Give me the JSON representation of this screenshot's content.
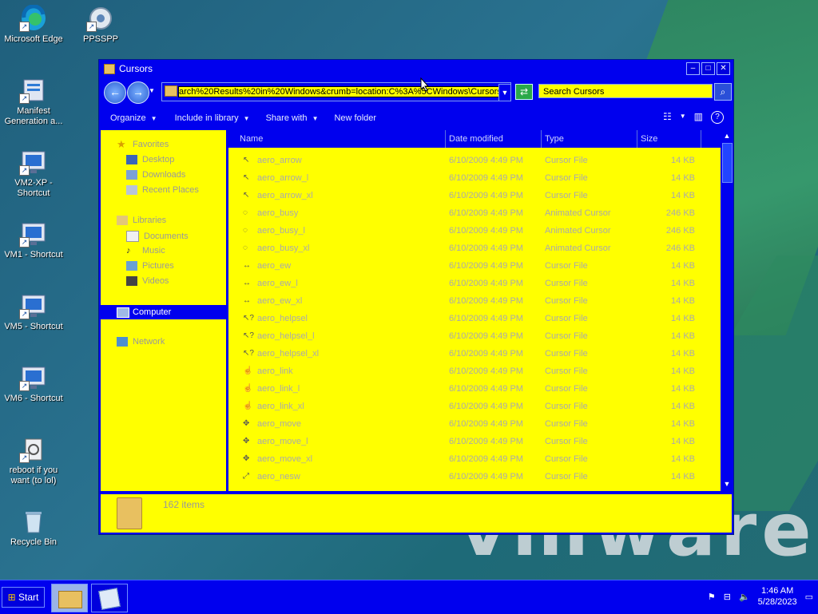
{
  "desktop": {
    "icons": [
      {
        "label": "Microsoft Edge"
      },
      {
        "label": "PPSSPP"
      },
      {
        "label": "Manifest Generation a..."
      },
      {
        "label": "VM2-XP - Shortcut"
      },
      {
        "label": "VM1 - Shortcut"
      },
      {
        "label": "VM5 - Shortcut"
      },
      {
        "label": "VM6 - Shortcut"
      },
      {
        "label": "reboot if you want (to lol)"
      },
      {
        "label": "Recycle Bin"
      }
    ],
    "wallpaper_text": "vmware"
  },
  "window": {
    "title": "Cursors",
    "address": "arch%20Results%20in%20Windows&crumb=location:C%3A%5CWindows\\Cursors",
    "search_placeholder": "Search Cursors",
    "commands": {
      "organize": "Organize",
      "include": "Include in library",
      "share": "Share with",
      "new_folder": "New folder"
    },
    "nav": {
      "favorites": "Favorites",
      "desktop": "Desktop",
      "downloads": "Downloads",
      "recent": "Recent Places",
      "libraries": "Libraries",
      "documents": "Documents",
      "music": "Music",
      "pictures": "Pictures",
      "videos": "Videos",
      "computer": "Computer",
      "network": "Network"
    },
    "columns": {
      "name": "Name",
      "date": "Date modified",
      "type": "Type",
      "size": "Size"
    },
    "files": [
      {
        "name": "aero_arrow",
        "date": "6/10/2009 4:49 PM",
        "type": "Cursor File",
        "size": "14 KB"
      },
      {
        "name": "aero_arrow_l",
        "date": "6/10/2009 4:49 PM",
        "type": "Cursor File",
        "size": "14 KB"
      },
      {
        "name": "aero_arrow_xl",
        "date": "6/10/2009 4:49 PM",
        "type": "Cursor File",
        "size": "14 KB"
      },
      {
        "name": "aero_busy",
        "date": "6/10/2009 4:49 PM",
        "type": "Animated Cursor",
        "size": "246 KB"
      },
      {
        "name": "aero_busy_l",
        "date": "6/10/2009 4:49 PM",
        "type": "Animated Cursor",
        "size": "246 KB"
      },
      {
        "name": "aero_busy_xl",
        "date": "6/10/2009 4:49 PM",
        "type": "Animated Cursor",
        "size": "246 KB"
      },
      {
        "name": "aero_ew",
        "date": "6/10/2009 4:49 PM",
        "type": "Cursor File",
        "size": "14 KB"
      },
      {
        "name": "aero_ew_l",
        "date": "6/10/2009 4:49 PM",
        "type": "Cursor File",
        "size": "14 KB"
      },
      {
        "name": "aero_ew_xl",
        "date": "6/10/2009 4:49 PM",
        "type": "Cursor File",
        "size": "14 KB"
      },
      {
        "name": "aero_helpsel",
        "date": "6/10/2009 4:49 PM",
        "type": "Cursor File",
        "size": "14 KB"
      },
      {
        "name": "aero_helpsel_l",
        "date": "6/10/2009 4:49 PM",
        "type": "Cursor File",
        "size": "14 KB"
      },
      {
        "name": "aero_helpsel_xl",
        "date": "6/10/2009 4:49 PM",
        "type": "Cursor File",
        "size": "14 KB"
      },
      {
        "name": "aero_link",
        "date": "6/10/2009 4:49 PM",
        "type": "Cursor File",
        "size": "14 KB"
      },
      {
        "name": "aero_link_l",
        "date": "6/10/2009 4:49 PM",
        "type": "Cursor File",
        "size": "14 KB"
      },
      {
        "name": "aero_link_xl",
        "date": "6/10/2009 4:49 PM",
        "type": "Cursor File",
        "size": "14 KB"
      },
      {
        "name": "aero_move",
        "date": "6/10/2009 4:49 PM",
        "type": "Cursor File",
        "size": "14 KB"
      },
      {
        "name": "aero_move_l",
        "date": "6/10/2009 4:49 PM",
        "type": "Cursor File",
        "size": "14 KB"
      },
      {
        "name": "aero_move_xl",
        "date": "6/10/2009 4:49 PM",
        "type": "Cursor File",
        "size": "14 KB"
      },
      {
        "name": "aero_nesw",
        "date": "6/10/2009 4:49 PM",
        "type": "Cursor File",
        "size": "14 KB"
      }
    ],
    "item_count": "162 items"
  },
  "taskbar": {
    "start_label": "Start",
    "time": "1:46 AM",
    "date": "5/28/2023"
  },
  "colors": {
    "window_blue": "#0000ee",
    "highlight_yellow": "#ffff00"
  }
}
